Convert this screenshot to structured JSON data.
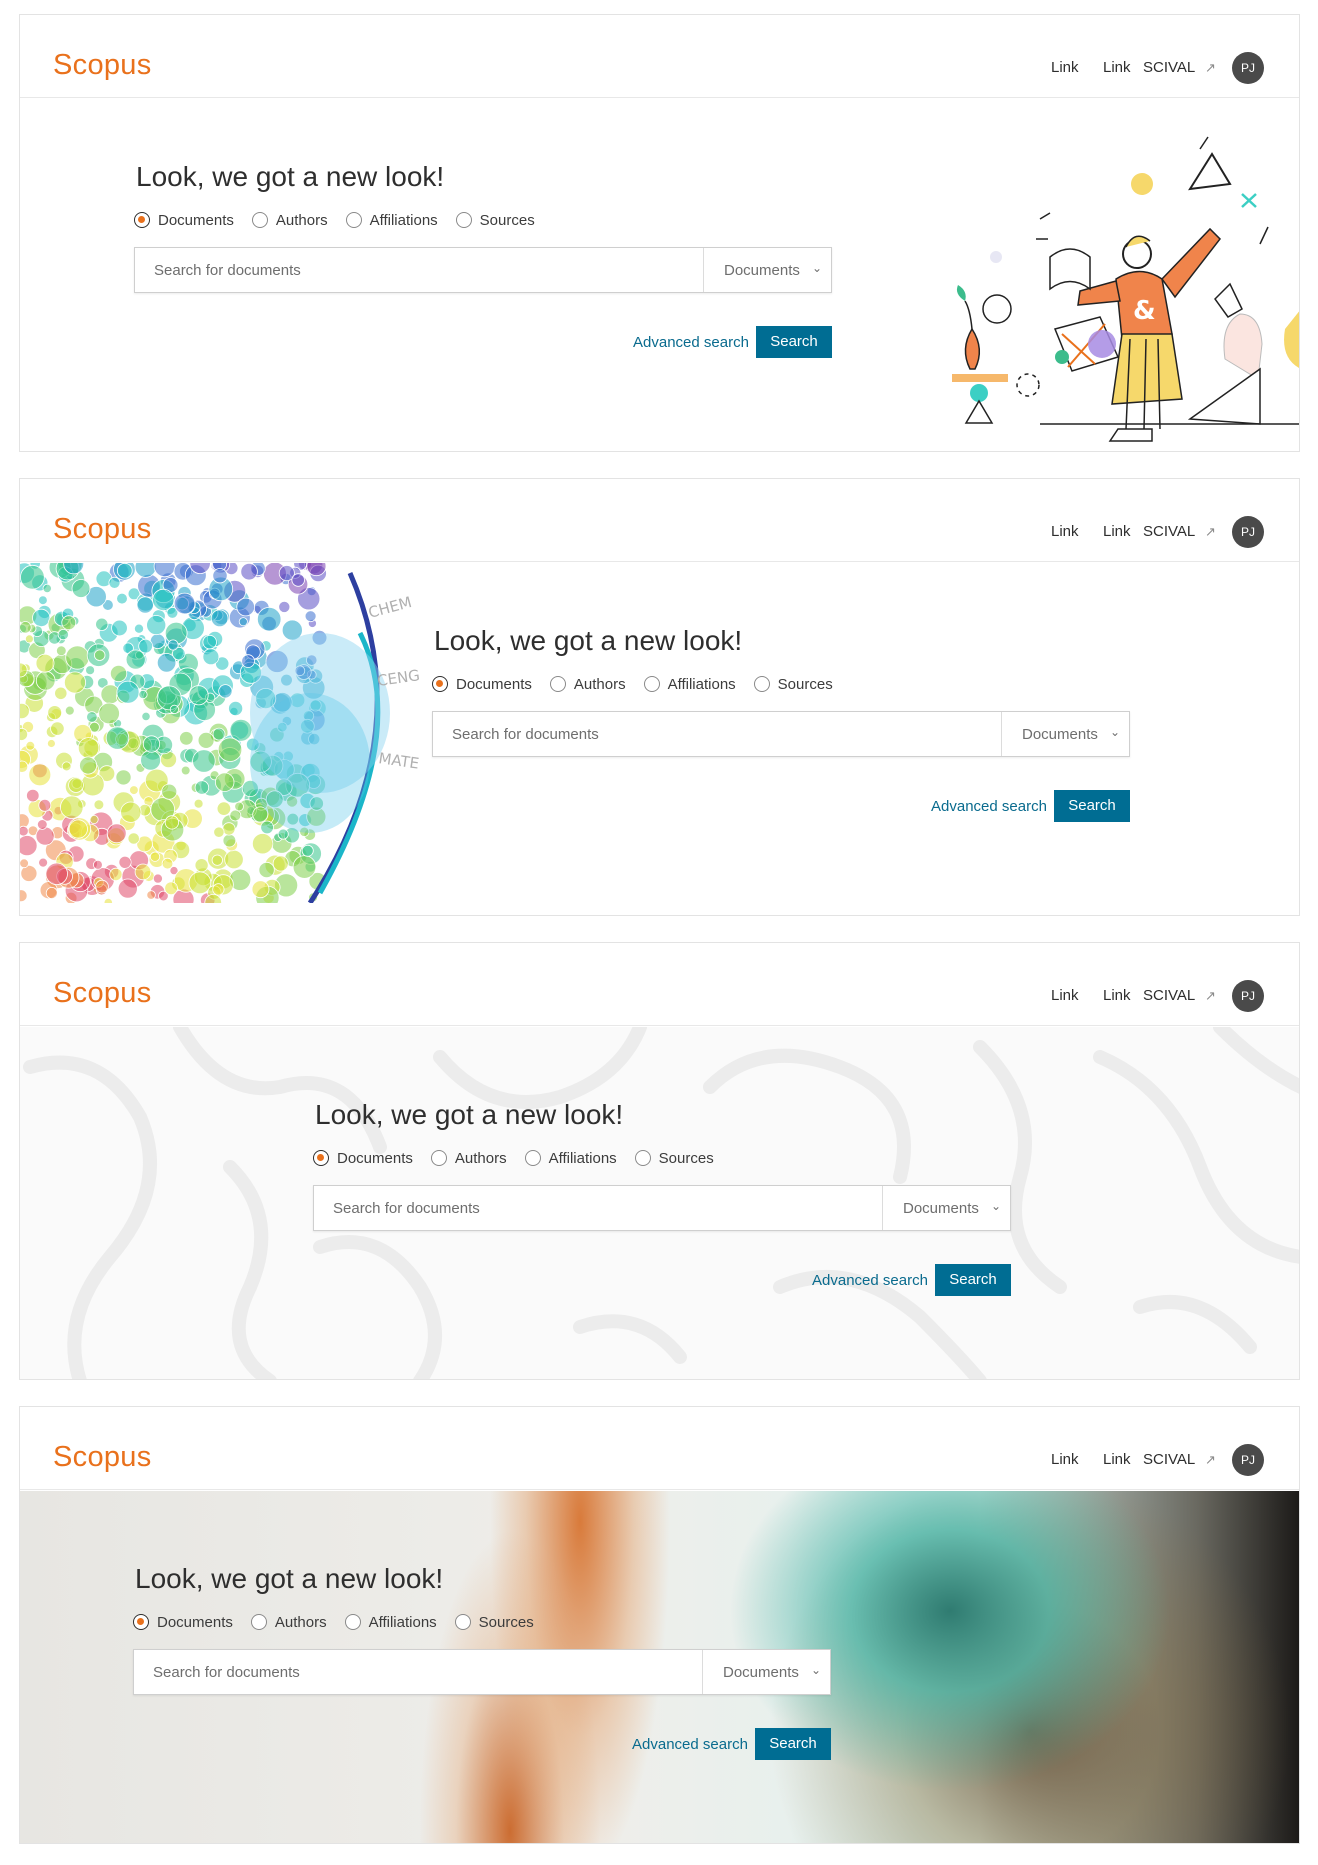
{
  "header": {
    "logo": "Scopus",
    "link1": "Link",
    "link2": "Link",
    "scival": "SCIVAL",
    "external_icon": "external-link-icon",
    "avatar_initials": "PJ"
  },
  "search": {
    "headline": "Look, we got a new look!",
    "radio_options": [
      "Documents",
      "Authors",
      "Affiliations",
      "Sources"
    ],
    "selected_option": "Documents",
    "placeholder": "Search for documents",
    "dropdown_value": "Documents",
    "advanced_link": "Advanced search",
    "search_button": "Search"
  },
  "variants": [
    {
      "id": "illustration",
      "hero_background": "illustration-of-person-with-geometric-shapes"
    },
    {
      "id": "bubble-chart",
      "hero_background": "colored-bubble-cluster-visualization",
      "bubble_labels": [
        "CHEM",
        "CENG",
        "MATE"
      ]
    },
    {
      "id": "pattern",
      "hero_background": "light-grey-leaf-outline-pattern"
    },
    {
      "id": "ink",
      "hero_background": "orange-and-teal-ink-photograph"
    }
  ],
  "colors": {
    "brand_orange": "#e9711c",
    "primary_blue": "#006d93",
    "link_blue": "#0a6b8e",
    "avatar_bg": "#4a4a4a"
  }
}
